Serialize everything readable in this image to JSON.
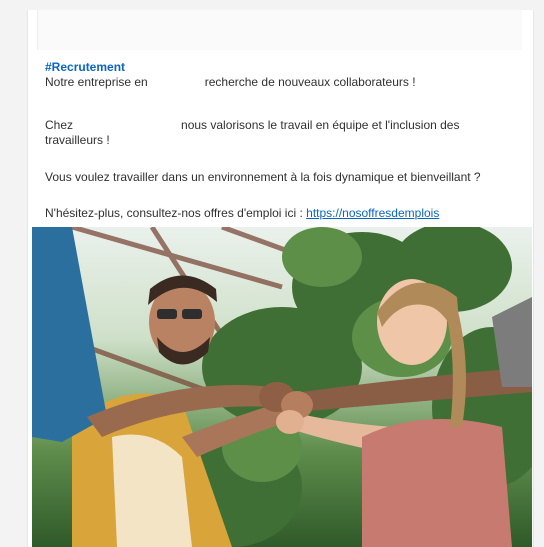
{
  "post": {
    "hashtag": "#Recrutement",
    "line1_a": "Notre entreprise en",
    "line1_b": "recherche de nouveaux collaborateurs !",
    "line2_a": "Chez",
    "line2_b": "nous valorisons le travail en équipe et l'inclusion des travailleurs !",
    "line3": "Vous voulez travailler dans un environnement à la fois dynamique et bienveillant ?",
    "line4_prefix": "N'hésitez-plus, consultez-nos offres d'emploi ici : ",
    "link_text": "https://nosoffresdemplois"
  },
  "colors": {
    "link": "#0a66c2",
    "hashtag": "#0a66c2"
  }
}
